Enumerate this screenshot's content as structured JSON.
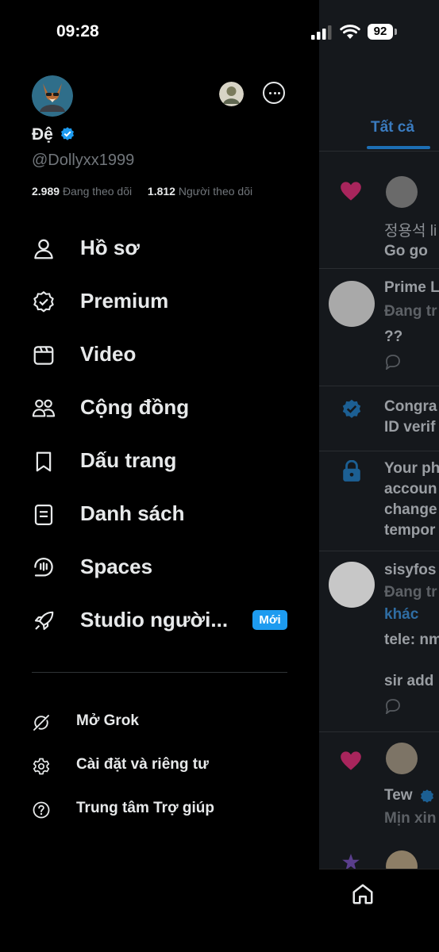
{
  "status_bar": {
    "time": "09:28",
    "battery": "92"
  },
  "profile": {
    "display_name": "Đệ",
    "handle": "@Dollyxx1999",
    "following_count": "2.989",
    "following_label": "Đang theo dõi",
    "followers_count": "1.812",
    "followers_label": "Người theo dõi"
  },
  "menu": [
    {
      "label": "Hồ sơ",
      "icon": "person-icon"
    },
    {
      "label": "Premium",
      "icon": "verified-badge-icon"
    },
    {
      "label": "Video",
      "icon": "video-icon"
    },
    {
      "label": "Cộng đồng",
      "icon": "communities-icon"
    },
    {
      "label": "Dấu trang",
      "icon": "bookmark-icon"
    },
    {
      "label": "Danh sách",
      "icon": "list-icon"
    },
    {
      "label": "Spaces",
      "icon": "spaces-icon"
    },
    {
      "label": "Studio người...",
      "icon": "rocket-icon",
      "badge": "Mới"
    }
  ],
  "secondary_menu": [
    {
      "label": "Mở Grok",
      "icon": "grok-icon"
    },
    {
      "label": "Cài đặt và riêng tư",
      "icon": "gear-icon"
    },
    {
      "label": "Trung tâm Trợ giúp",
      "icon": "help-icon"
    }
  ],
  "feed": {
    "tab": "Tất cả",
    "items": [
      {
        "line1": "정용석 li",
        "line2": "Go go"
      },
      {
        "name": "Prime L",
        "line2": "Đang tr",
        "line3": "??"
      },
      {
        "line1": "Congra",
        "line2": "ID verif"
      },
      {
        "line1": "Your ph",
        "line2": "accoun",
        "line3": "change",
        "line4": "tempor"
      },
      {
        "name": "sisyfos",
        "line2": "Đang tr",
        "link": "khác",
        "line3": "tele: nm",
        "line4": "sir add"
      },
      {
        "name": "Tew",
        "line2": "Mịn xin"
      }
    ]
  },
  "colors": {
    "accent": "#1d9bf0",
    "like": "#f91880",
    "background": "#000000"
  }
}
